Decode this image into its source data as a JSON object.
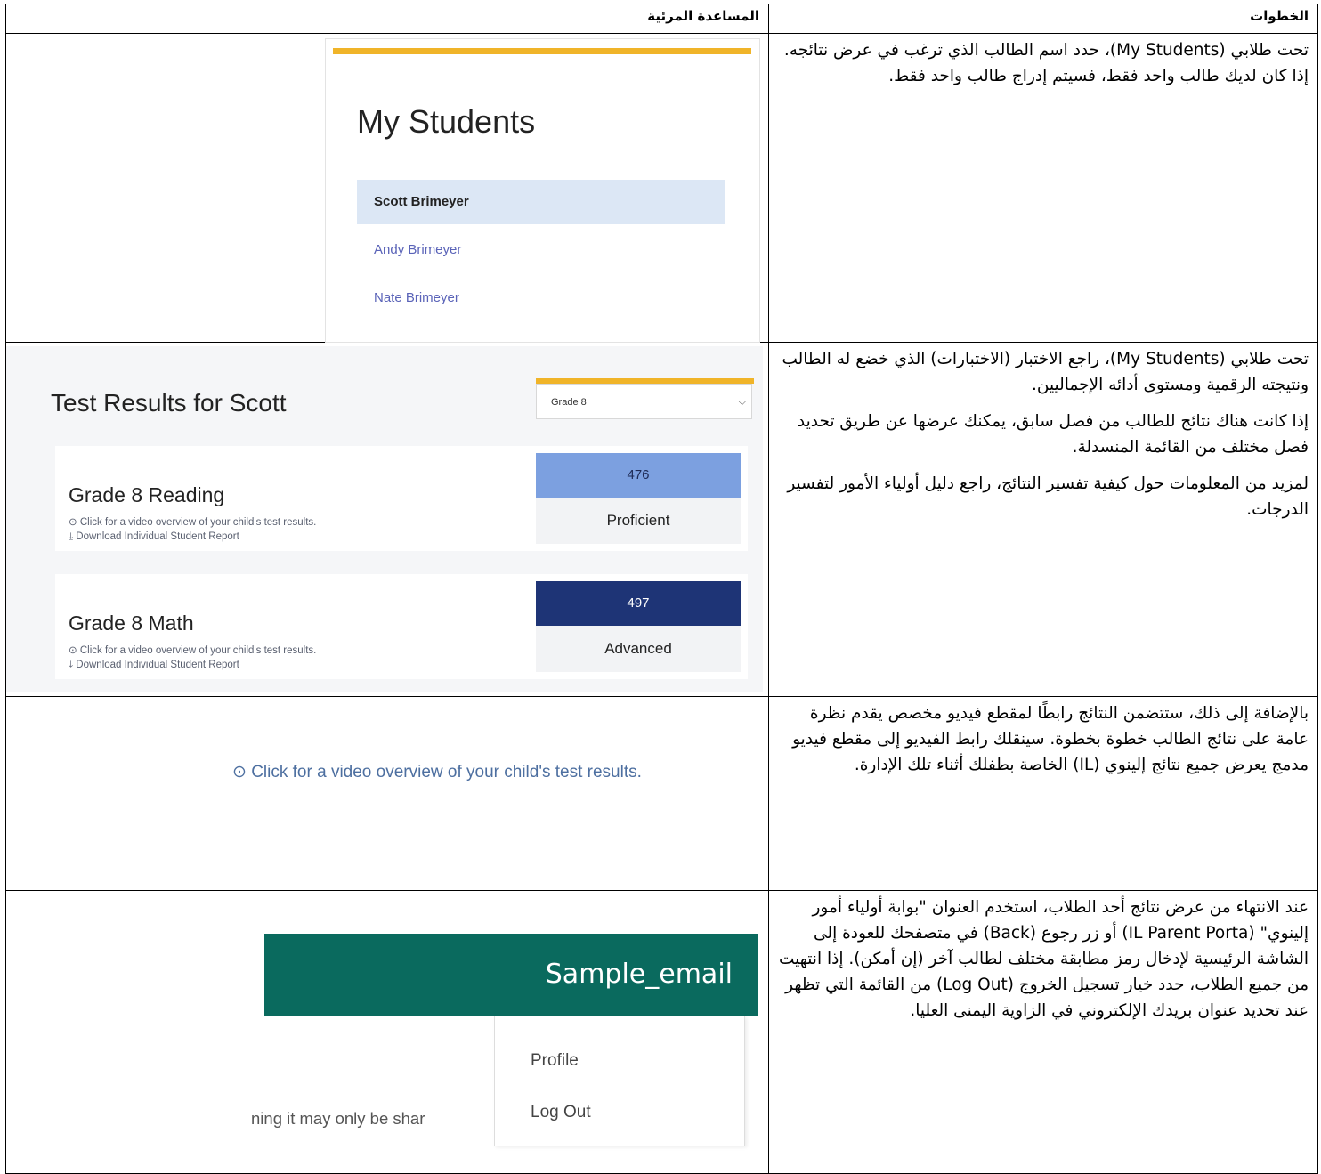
{
  "headers": {
    "visual": "المساعدة المرئية",
    "steps": "الخطوات"
  },
  "rows": [
    {
      "steps": [
        "تحت طلابي (My Students)، حدد اسم الطالب الذي ترغب في عرض نتائجه. إذا كان لديك طالب واحد فقط، فسيتم إدراج طالب واحد فقط."
      ],
      "visual": {
        "title": "My Students",
        "students": [
          "Scott Brimeyer",
          "Andy Brimeyer",
          "Nate Brimeyer"
        ]
      }
    },
    {
      "steps": [
        "تحت طلابي (My Students)، راجع الاختبار (الاختبارات) الذي خضع له الطالب ونتيجته الرقمية ومستوى أدائه الإجماليين.",
        "إذا كانت هناك نتائج للطالب من فصل سابق، يمكنك عرضها عن طريق تحديد فصل مختلف من القائمة المنسدلة.",
        "لمزيد من المعلومات حول كيفية تفسير النتائج، راجع دليل أولياء الأمور لتفسير الدرجات."
      ],
      "visual": {
        "title": "Test Results for Scott",
        "grade_select": "Grade 8",
        "tests": [
          {
            "name": "Grade 8 Reading",
            "score": "476",
            "level": "Proficient",
            "video_link": "Click for a video overview of your child's test results.",
            "download_link": "Download Individual Student Report"
          },
          {
            "name": "Grade 8 Math",
            "score": "497",
            "level": "Advanced",
            "video_link": "Click for a video overview of your child's test results.",
            "download_link": "Download Individual Student Report"
          }
        ],
        "colors": {
          "proficient": "#7ca0e0",
          "advanced": "#1e3476",
          "accent": "#f0b429"
        }
      }
    },
    {
      "steps": [
        "بالإضافة إلى ذلك، ستتضمن النتائج رابطًا لمقطع فيديو مخصص يقدم نظرة عامة على نتائج الطالب خطوة بخطوة. سينقلك رابط الفيديو إلى مقطع فيديو مدمج يعرض جميع نتائج إلينوي (IL) الخاصة بطفلك أثناء تلك الإدارة."
      ],
      "visual": {
        "video_link": "Click for a video overview of your child's test results."
      }
    },
    {
      "steps": [
        "عند الانتهاء من عرض نتائج أحد الطلاب، استخدم العنوان \"بوابة أولياء أمور إلينوي\" (IL Parent Porta) أو زر رجوع (Back) في متصفحك للعودة إلى الشاشة الرئيسية لإدخال رمز مطابقة مختلف لطالب آخر (إن أمكن). إذا انتهيت من جميع الطلاب، حدد خيار تسجيل الخروج (Log Out) من القائمة التي تظهر عند تحديد عنوان بريدك الإلكتروني في الزاوية اليمنى العليا."
      ],
      "visual": {
        "email": "Sample_email",
        "menu": [
          "Profile",
          "Log Out"
        ],
        "partial_text": "ning it may only be shar",
        "colors": {
          "header": "#0a6a5e"
        }
      }
    }
  ]
}
